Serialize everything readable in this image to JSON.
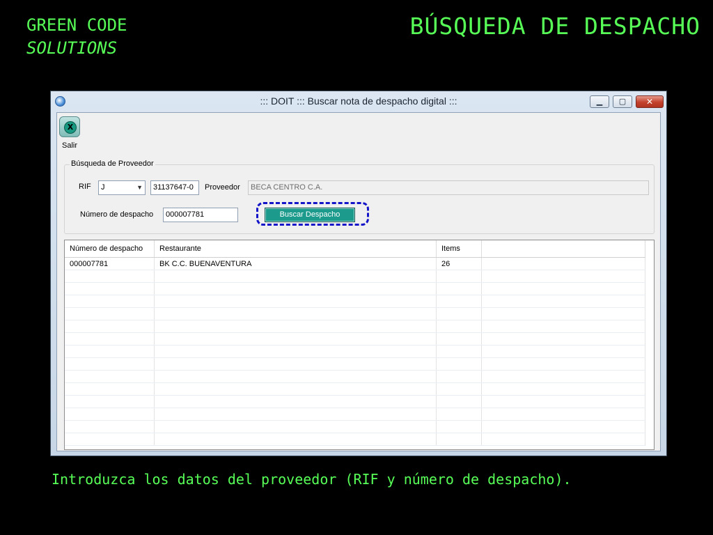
{
  "slide": {
    "brand_line1": "GREEN CODE",
    "brand_line2": "SOLUTIONS",
    "title": "BÚSQUEDA DE DESPACHO",
    "caption": "Introduzca los datos del proveedor (RIF y número de despacho)."
  },
  "window": {
    "title": "::: DOIT ::: Buscar nota de despacho digital :::",
    "minimize_glyph": "▁",
    "maximize_glyph": "▢",
    "close_glyph": "✕"
  },
  "toolbar": {
    "exit_label": "Salir",
    "exit_glyph": "X"
  },
  "group": {
    "legend": "Búsqueda de Proveedor",
    "rif_label": "RIF",
    "rif_type": "J",
    "rif_number": "31137647-0",
    "proveedor_label": "Proveedor",
    "proveedor_value": "BECA CENTRO C.A.",
    "despacho_label": "Número de despacho",
    "despacho_value": "000007781",
    "search_button": "Buscar Despacho"
  },
  "grid": {
    "columns": [
      "Número de despacho",
      "Restaurante",
      "Items",
      ""
    ],
    "rows": [
      [
        "000007781",
        "BK C.C. BUENAVENTURA",
        "26",
        ""
      ]
    ]
  },
  "colors": {
    "slide_text": "#57ff57",
    "highlight_border": "#1414c8",
    "search_button": "#1c9a8c"
  }
}
